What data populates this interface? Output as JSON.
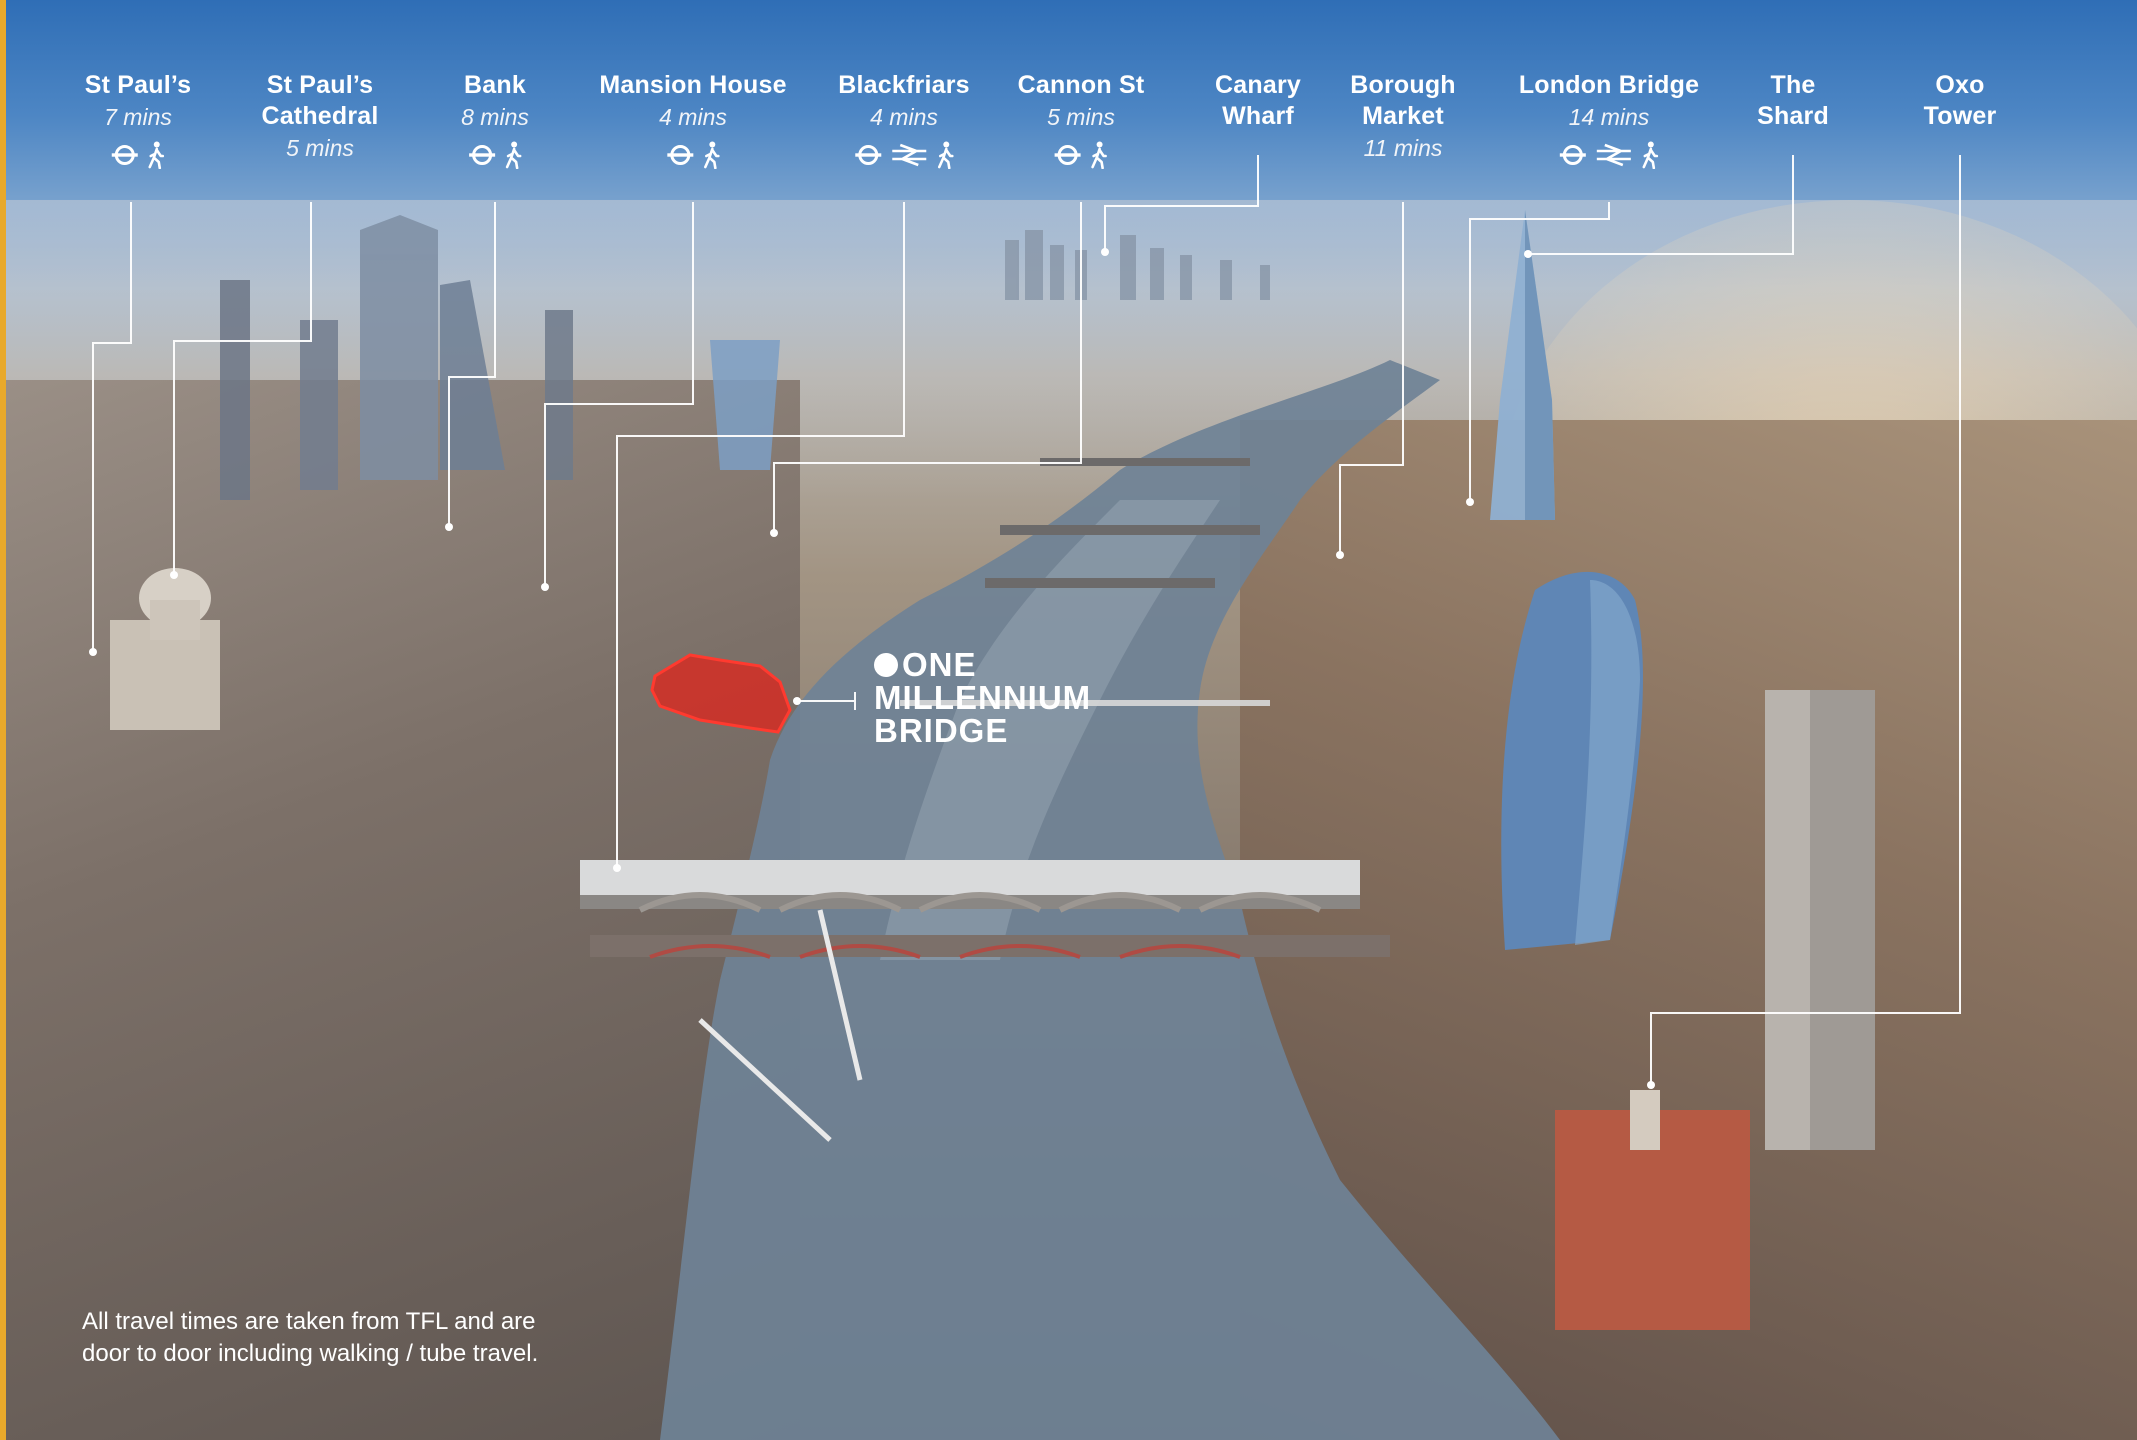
{
  "stations": [
    {
      "id": "st-pauls",
      "name_lines": [
        "St Paul’s"
      ],
      "time": "7 mins",
      "icons": [
        "underground-icon",
        "walking-icon"
      ]
    },
    {
      "id": "st-pauls-cathedral",
      "name_lines": [
        "St Paul’s",
        "Cathedral"
      ],
      "time": "5 mins",
      "icons": []
    },
    {
      "id": "bank",
      "name_lines": [
        "Bank"
      ],
      "time": "8 mins",
      "icons": [
        "underground-icon",
        "walking-icon"
      ]
    },
    {
      "id": "mansion-house",
      "name_lines": [
        "Mansion House"
      ],
      "time": "4 mins",
      "icons": [
        "underground-icon",
        "walking-icon"
      ]
    },
    {
      "id": "blackfriars",
      "name_lines": [
        "Blackfriars"
      ],
      "time": "4 mins",
      "icons": [
        "underground-icon",
        "national-rail-icon",
        "walking-icon"
      ]
    },
    {
      "id": "cannon-st",
      "name_lines": [
        "Cannon St"
      ],
      "time": "5 mins",
      "icons": [
        "underground-icon",
        "walking-icon"
      ]
    },
    {
      "id": "canary-wharf",
      "name_lines": [
        "Canary",
        "Wharf"
      ],
      "time": "",
      "icons": []
    },
    {
      "id": "borough-market",
      "name_lines": [
        "Borough",
        "Market"
      ],
      "time": "11 mins",
      "icons": []
    },
    {
      "id": "london-bridge",
      "name_lines": [
        "London Bridge"
      ],
      "time": "14 mins",
      "icons": [
        "underground-icon",
        "national-rail-icon",
        "walking-icon"
      ]
    },
    {
      "id": "the-shard",
      "name_lines": [
        "The",
        "Shard"
      ],
      "time": "",
      "icons": []
    },
    {
      "id": "oxo-tower",
      "name_lines": [
        "Oxo",
        "Tower"
      ],
      "time": "",
      "icons": []
    }
  ],
  "site": {
    "line1": "ONE",
    "line2": "MILLENNIUM",
    "line3": "BRIDGE",
    "marker_color": "#e0241b"
  },
  "disclaimer": {
    "line1": "All travel times are taken from TFL and are",
    "line2": "door to door including walking / tube travel."
  },
  "colors": {
    "accent_bar": "#e8a92b",
    "text": "#ffffff",
    "site_red": "#e0241b"
  }
}
